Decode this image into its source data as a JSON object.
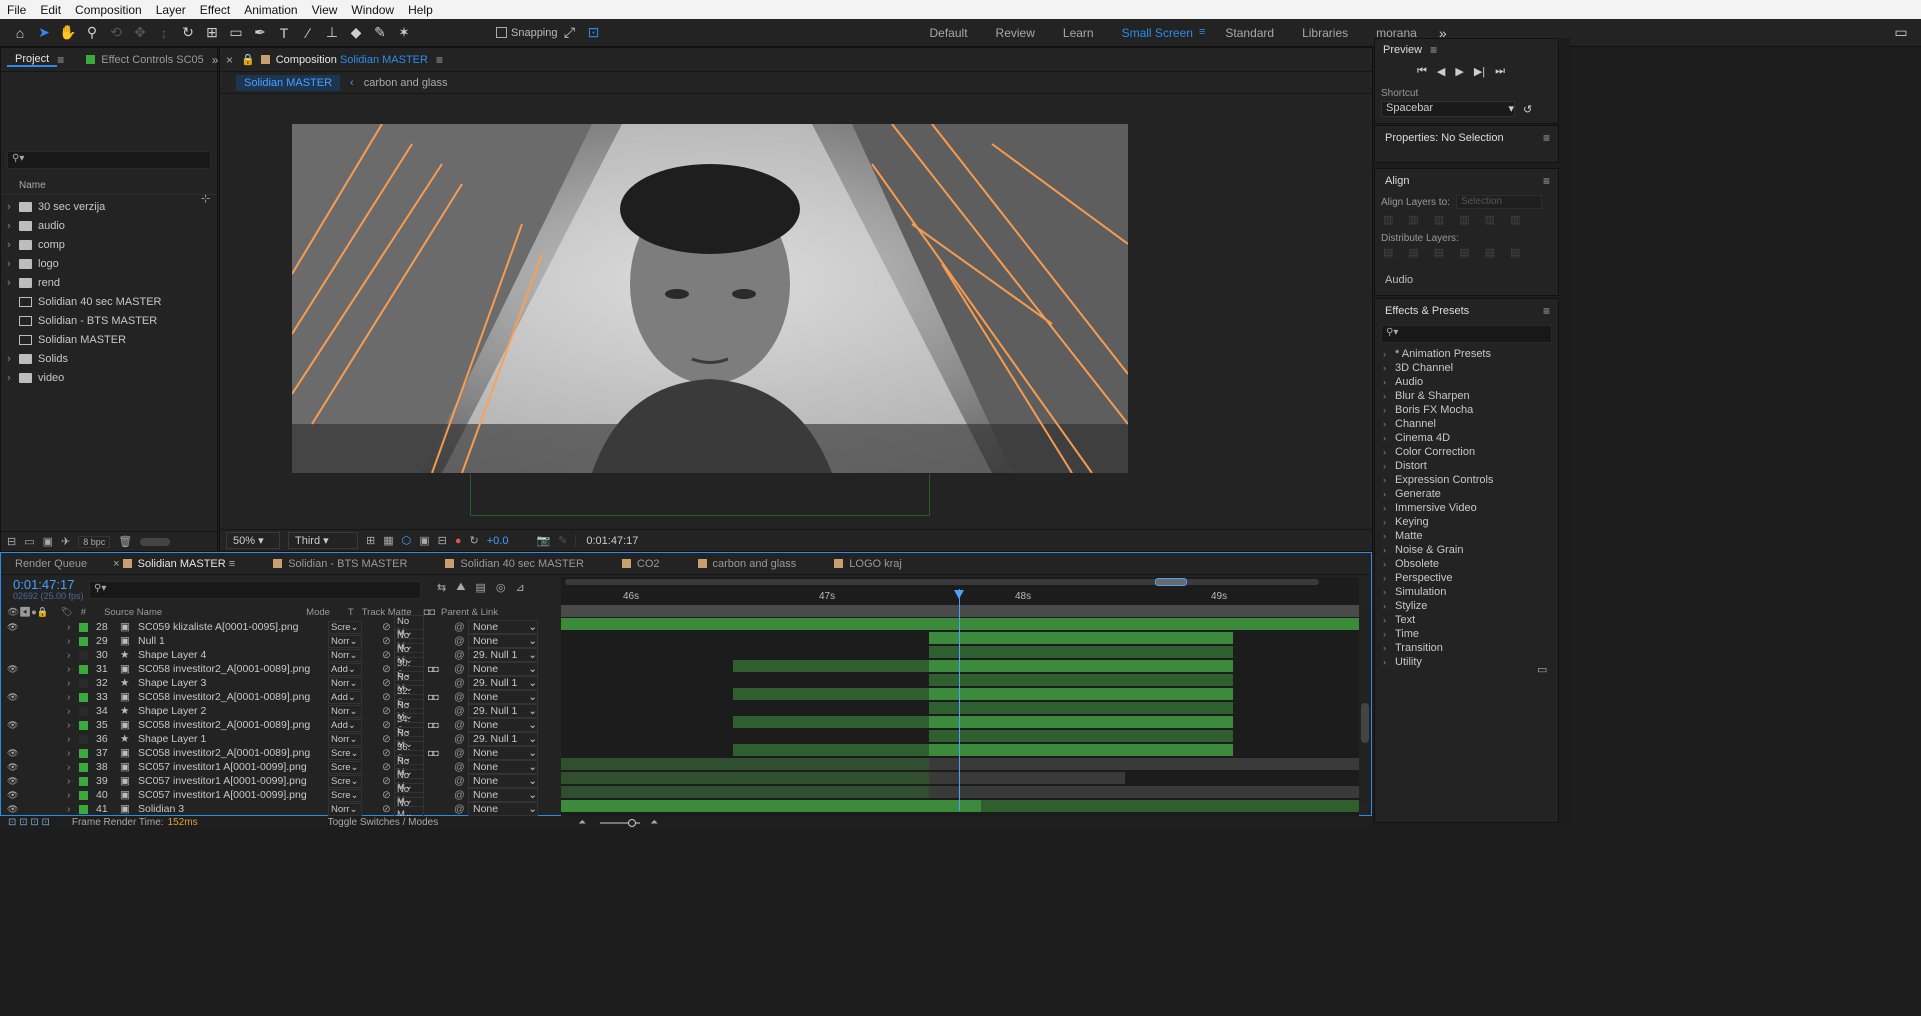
{
  "menu": [
    "File",
    "Edit",
    "Composition",
    "Layer",
    "Effect",
    "Animation",
    "View",
    "Window",
    "Help"
  ],
  "toolbar": {
    "snapping_label": "Snapping"
  },
  "workspaces": [
    {
      "label": "Default",
      "active": false
    },
    {
      "label": "Review",
      "active": false
    },
    {
      "label": "Learn",
      "active": false
    },
    {
      "label": "Small Screen",
      "active": true
    },
    {
      "label": "Standard",
      "active": false
    },
    {
      "label": "Libraries",
      "active": false
    },
    {
      "label": "morana",
      "active": false
    }
  ],
  "project": {
    "tab_project": "Project",
    "tab_effect_controls": "Effect Controls SC05",
    "name_header": "Name",
    "items": [
      {
        "label": "30 sec verzija",
        "type": "folder"
      },
      {
        "label": "audio",
        "type": "folder"
      },
      {
        "label": "comp",
        "type": "folder"
      },
      {
        "label": "logo",
        "type": "folder"
      },
      {
        "label": "rend",
        "type": "folder"
      },
      {
        "label": "Solidian 40 sec MASTER",
        "type": "comp"
      },
      {
        "label": "Solidian - BTS MASTER",
        "type": "comp"
      },
      {
        "label": "Solidian MASTER",
        "type": "comp"
      },
      {
        "label": "Solids",
        "type": "folder"
      },
      {
        "label": "video",
        "type": "folder"
      }
    ],
    "bpc": "8 bpc"
  },
  "composition": {
    "tab_prefix": "Composition",
    "tab_name": "Solidian MASTER",
    "breadcrumb": [
      "Solidian MASTER",
      "carbon and glass"
    ],
    "zoom": "50%",
    "resolution": "Third",
    "exposure": "+0.0",
    "timecode": "0:01:47:17"
  },
  "preview": {
    "title": "Preview",
    "shortcut_label": "Shortcut",
    "shortcut_value": "Spacebar"
  },
  "properties": {
    "title": "Properties: No Selection"
  },
  "align": {
    "title": "Align",
    "align_to_label": "Align Layers to:",
    "align_to_value": "Selection",
    "distribute_label": "Distribute Layers:",
    "audio_label": "Audio"
  },
  "effects": {
    "title": "Effects & Presets",
    "items": [
      "* Animation Presets",
      "3D Channel",
      "Audio",
      "Blur & Sharpen",
      "Boris FX Mocha",
      "Channel",
      "Cinema 4D",
      "Color Correction",
      "Distort",
      "Expression Controls",
      "Generate",
      "Immersive Video",
      "Keying",
      "Matte",
      "Noise & Grain",
      "Obsolete",
      "Perspective",
      "Simulation",
      "Stylize",
      "Text",
      "Time",
      "Transition",
      "Utility"
    ]
  },
  "timeline": {
    "tabs": [
      {
        "label": "Render Queue",
        "active": false,
        "color": ""
      },
      {
        "label": "Solidian MASTER",
        "active": true,
        "color": "#c8a070"
      },
      {
        "label": "Solidian - BTS MASTER",
        "active": false,
        "color": "#c8a070"
      },
      {
        "label": "Solidian 40 sec MASTER",
        "active": false,
        "color": "#c8a070"
      },
      {
        "label": "CO2",
        "active": false,
        "color": "#c8a070"
      },
      {
        "label": "carbon and glass",
        "active": false,
        "color": "#c8a070"
      },
      {
        "label": "LOGO kraj",
        "active": false,
        "color": "#c8a070"
      }
    ],
    "current_time": "0:01:47:17",
    "current_frame": "02692 (25.00 fps)",
    "col_source": "Source Name",
    "col_mode": "Mode",
    "col_t": "T",
    "col_track_matte": "Track Matte",
    "col_parent": "Parent & Link",
    "ruler": [
      "46s",
      "47s",
      "48s",
      "49s"
    ],
    "layers": [
      {
        "num": "28",
        "name": "SC059 klizaliste A[0001-0095].png",
        "mode": "Scre",
        "matte": "No M",
        "parent": "None",
        "color": "#3aaa3a",
        "star": false,
        "eye": true
      },
      {
        "num": "29",
        "name": "Null 1",
        "mode": "Norr",
        "matte": "No M",
        "parent": "None",
        "color": "#3aaa3a",
        "star": false,
        "eye": false
      },
      {
        "num": "30",
        "name": "Shape Layer 4",
        "mode": "Norr",
        "matte": "No M",
        "parent": "29. Null 1",
        "color": "",
        "star": true,
        "eye": false
      },
      {
        "num": "31",
        "name": "SC058 investitor2_A[0001-0089].png",
        "mode": "Add",
        "matte": "30. S",
        "parent": "None",
        "color": "#3aaa3a",
        "star": false,
        "eye": true
      },
      {
        "num": "32",
        "name": "Shape Layer 3",
        "mode": "Norr",
        "matte": "No M",
        "parent": "29. Null 1",
        "color": "",
        "star": true,
        "eye": false
      },
      {
        "num": "33",
        "name": "SC058 investitor2_A[0001-0089].png",
        "mode": "Add",
        "matte": "32. S",
        "parent": "None",
        "color": "#3aaa3a",
        "star": false,
        "eye": true
      },
      {
        "num": "34",
        "name": "Shape Layer 2",
        "mode": "Norr",
        "matte": "No M",
        "parent": "29. Null 1",
        "color": "",
        "star": true,
        "eye": false
      },
      {
        "num": "35",
        "name": "SC058 investitor2_A[0001-0089].png",
        "mode": "Add",
        "matte": "34. S",
        "parent": "None",
        "color": "#3aaa3a",
        "star": false,
        "eye": true
      },
      {
        "num": "36",
        "name": "Shape Layer 1",
        "mode": "Norr",
        "matte": "No M",
        "parent": "29. Null 1",
        "color": "",
        "star": true,
        "eye": false
      },
      {
        "num": "37",
        "name": "SC058 investitor2_A[0001-0089].png",
        "mode": "Scre",
        "matte": "36. S",
        "parent": "None",
        "color": "#3aaa3a",
        "star": false,
        "eye": true
      },
      {
        "num": "38",
        "name": "SC057 investitor1 A[0001-0099].png",
        "mode": "Scre",
        "matte": "No M",
        "parent": "None",
        "color": "#3aaa3a",
        "star": false,
        "eye": true
      },
      {
        "num": "39",
        "name": "SC057 investitor1 A[0001-0099].png",
        "mode": "Scre",
        "matte": "No M",
        "parent": "None",
        "color": "#3aaa3a",
        "star": false,
        "eye": true
      },
      {
        "num": "40",
        "name": "SC057 investitor1 A[0001-0099].png",
        "mode": "Scre",
        "matte": "No M",
        "parent": "None",
        "color": "#3aaa3a",
        "star": false,
        "eye": true
      },
      {
        "num": "41",
        "name": "Solidian 3",
        "mode": "Norr",
        "matte": "No M",
        "parent": "None",
        "color": "#3aaa3a",
        "star": false,
        "eye": true
      }
    ],
    "footer_render_label": "Frame Render Time:",
    "footer_render_value": "152ms",
    "footer_toggle": "Toggle Switches / Modes"
  },
  "colors": {
    "accent": "#2d8ceb",
    "layer_green": "#3aaa3a",
    "render_time": "#e0a030"
  }
}
